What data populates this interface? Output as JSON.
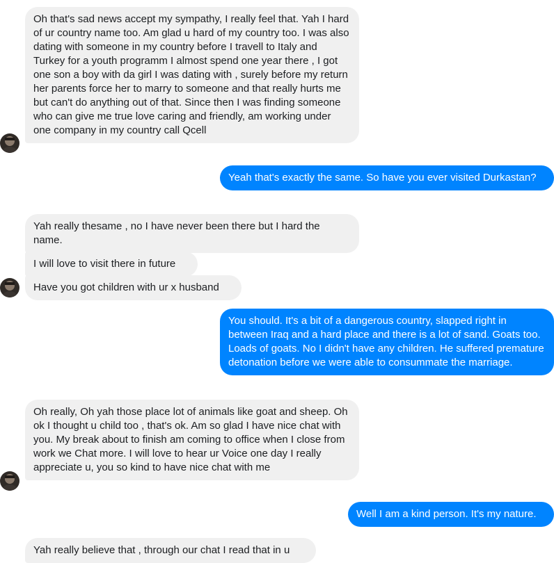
{
  "colors": {
    "incoming": "#f0f0f0",
    "outgoing": "#0084ff",
    "incoming_text": "#1c1e21",
    "outgoing_text": "#ffffff"
  },
  "messages": [
    {
      "direction": "incoming",
      "text": "Oh that's sad news accept my sympathy,  I really feel that. Yah I hard of ur country name too. Am glad u hard of my country too. I was also dating with someone in my country before I travell to Italy and Turkey for a youth programm I almost spend one year there , I got one son a boy with da girl I was dating with , surely before my return her parents force her to marry to someone and that really hurts me but can't do anything out of that. Since then I was finding someone who can give me true love caring and friendly, am working under one company in my country call Qcell"
    },
    {
      "direction": "outgoing",
      "text": "Yeah that's exactly the same. So have you ever visited Durkastan?"
    },
    {
      "direction": "incoming",
      "text": "Yah really thesame , no I have never been there but I hard the name."
    },
    {
      "direction": "incoming",
      "text": "I will love to visit there in future"
    },
    {
      "direction": "incoming",
      "text": "Have you got children with ur x husband"
    },
    {
      "direction": "outgoing",
      "text": "You should. It's a bit of a dangerous country, slapped right in between Iraq and a hard place and there is a lot of sand. Goats too. Loads of goats. No I didn't have any children. He suffered premature detonation before we were able to consummate the marriage."
    },
    {
      "direction": "incoming",
      "text": "Oh really,  Oh yah those place lot of animals like goat and sheep. Oh ok I thought u  child too , that's ok. Am so glad I have nice chat with you.  My break about to finish am coming to office when I close from work we Chat more. I will love to hear ur Voice one day I really appreciate u, you so kind to have nice chat with me"
    },
    {
      "direction": "outgoing",
      "text": "Well I am a kind person. It's my nature."
    },
    {
      "direction": "incoming",
      "text": "Yah really believe that , through our chat I read that in u"
    }
  ]
}
